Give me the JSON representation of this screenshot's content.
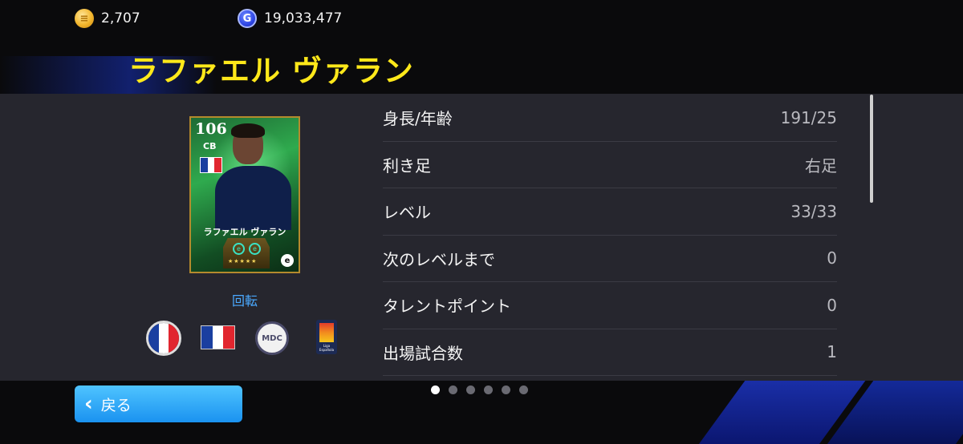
{
  "currency": {
    "coins": "2,707",
    "gp": "19,033,477",
    "coin_icon_glyph": "≡",
    "gp_icon_glyph": "G"
  },
  "player": {
    "name": "ラファエル ヴァラン"
  },
  "card": {
    "rating": "106",
    "position": "CB",
    "name": "ラファエル ヴァラン",
    "stars": "★★★★★",
    "logo": "e",
    "flag_colors": [
      "#1a3fa0",
      "#ffffff",
      "#e1262f"
    ]
  },
  "rotate_label": "回転",
  "club_badge_text": "MDC",
  "league_badge_text": "Liga Española",
  "stats": [
    {
      "label": "身長/年齢",
      "value": "191/25"
    },
    {
      "label": "利き足",
      "value": "右足"
    },
    {
      "label": "レベル",
      "value": "33/33"
    },
    {
      "label": "次のレベルまで",
      "value": "0"
    },
    {
      "label": "タレントポイント",
      "value": "0"
    },
    {
      "label": "出場試合数",
      "value": "1"
    }
  ],
  "back_button": {
    "label": "戻る"
  },
  "pager": {
    "total": 6,
    "active": 0
  },
  "colors": {
    "title": "#ffe81a",
    "panel": "#26262e",
    "accent_blue": "#1a92f0",
    "link": "#4aa9ff"
  }
}
